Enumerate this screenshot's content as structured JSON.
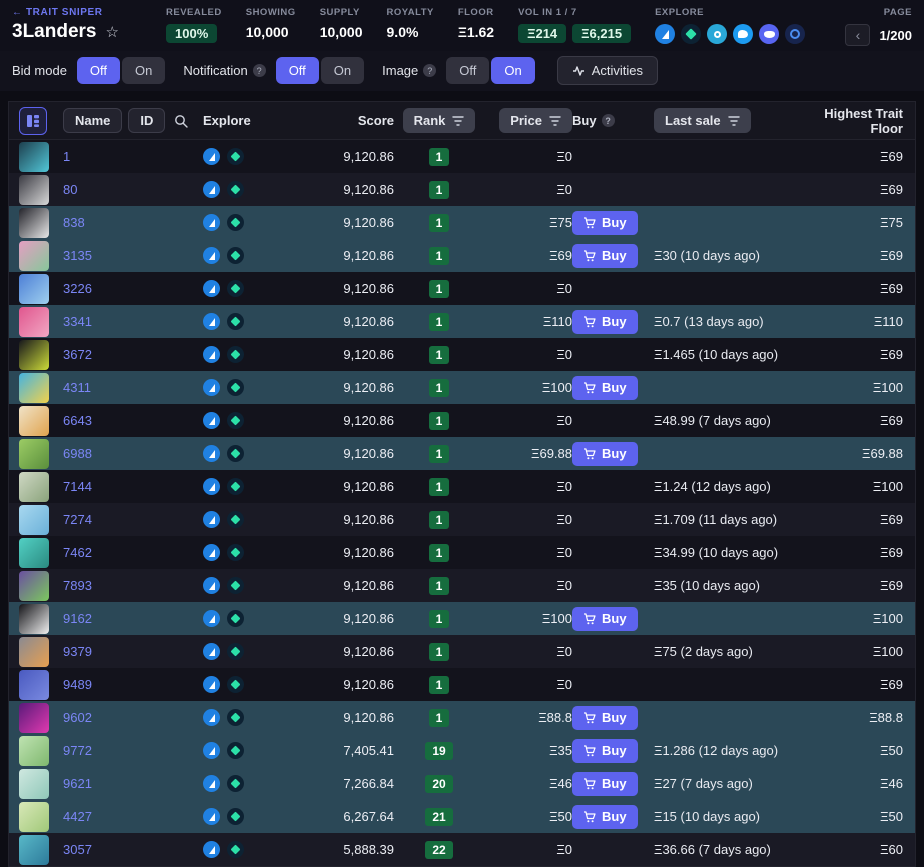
{
  "ui": {
    "help": "?",
    "star": "☆",
    "prev": "‹"
  },
  "header": {
    "breadcrumb": "← TRAIT SNIPER",
    "title": "3Landers",
    "stats": {
      "revealed": {
        "label": "REVEALED",
        "value": "100%"
      },
      "showing": {
        "label": "SHOWING",
        "value": "10,000"
      },
      "supply": {
        "label": "SUPPLY",
        "value": "10,000"
      },
      "royalty": {
        "label": "ROYALTY",
        "value": "9.0%"
      },
      "floor": {
        "label": "FLOOR",
        "value": "Ξ1.62"
      },
      "volume": {
        "label": "VOL IN 1 / 7",
        "day": "Ξ214",
        "week": "Ξ6,215"
      }
    },
    "explore_label": "EXPLORE",
    "explore_icons": [
      {
        "name": "opensea",
        "color": "#2081e2",
        "shape": "shape-sail"
      },
      {
        "name": "gem",
        "color": "#0d2233",
        "shape": "shape-diamond"
      },
      {
        "name": "x2y2",
        "color": "#2aa8d8",
        "shape": "shape-ring"
      },
      {
        "name": "twitter",
        "color": "#1d9bf0",
        "shape": "shape-bird"
      },
      {
        "name": "discord",
        "color": "#5865f2",
        "shape": "shape-blob"
      },
      {
        "name": "website",
        "color": "#17244d",
        "shape": "shape-globe"
      }
    ],
    "page_label": "PAGE",
    "page_value": "1/200"
  },
  "filterbar": {
    "bid_mode_label": "Bid mode",
    "notification_label": "Notification",
    "image_label": "Image",
    "off": "Off",
    "on": "On",
    "bid_mode_state": "Off",
    "notification_state": "Off",
    "image_state": "On",
    "activities_label": "Activities"
  },
  "table": {
    "buy_label": "Buy",
    "header": {
      "name": "Name",
      "id": "ID",
      "explore": "Explore",
      "score": "Score",
      "rank": "Rank",
      "price": "Price",
      "buy": "Buy",
      "last_sale": "Last sale",
      "highest_trait_floor": "Highest Trait Floor"
    },
    "rows": [
      {
        "id": "1",
        "score": "9,120.86",
        "rank": "1",
        "price": "Ξ0",
        "buy": false,
        "last_sale": "",
        "htf": "Ξ69",
        "thumb": [
          "#1d3f4e",
          "#52c7d8"
        ]
      },
      {
        "id": "80",
        "score": "9,120.86",
        "rank": "1",
        "price": "Ξ0",
        "buy": false,
        "last_sale": "",
        "htf": "Ξ69",
        "thumb": [
          "#3a3a42",
          "#d8d8d8"
        ]
      },
      {
        "id": "838",
        "score": "9,120.86",
        "rank": "1",
        "price": "Ξ75",
        "buy": true,
        "last_sale": "",
        "htf": "Ξ75",
        "thumb": [
          "#23232a",
          "#e8e8e8"
        ]
      },
      {
        "id": "3135",
        "score": "9,120.86",
        "rank": "1",
        "price": "Ξ69",
        "buy": true,
        "last_sale": "Ξ30 (10 days ago)",
        "htf": "Ξ69",
        "thumb": [
          "#e59ec2",
          "#86c79a"
        ]
      },
      {
        "id": "3226",
        "score": "9,120.86",
        "rank": "1",
        "price": "Ξ0",
        "buy": false,
        "last_sale": "",
        "htf": "Ξ69",
        "thumb": [
          "#4d7fd6",
          "#9fd0ef"
        ]
      },
      {
        "id": "3341",
        "score": "9,120.86",
        "rank": "1",
        "price": "Ξ110",
        "buy": true,
        "last_sale": "Ξ0.7 (13 days ago)",
        "htf": "Ξ110",
        "thumb": [
          "#e0568e",
          "#f2a7c3"
        ]
      },
      {
        "id": "3672",
        "score": "9,120.86",
        "rank": "1",
        "price": "Ξ0",
        "buy": false,
        "last_sale": "Ξ1.465 (10 days ago)",
        "htf": "Ξ69",
        "thumb": [
          "#17171c",
          "#cddc39"
        ]
      },
      {
        "id": "4311",
        "score": "9,120.86",
        "rank": "1",
        "price": "Ξ100",
        "buy": true,
        "last_sale": "",
        "htf": "Ξ100",
        "thumb": [
          "#45b3e0",
          "#f2d24b"
        ]
      },
      {
        "id": "6643",
        "score": "9,120.86",
        "rank": "1",
        "price": "Ξ0",
        "buy": false,
        "last_sale": "Ξ48.99 (7 days ago)",
        "htf": "Ξ69",
        "thumb": [
          "#f0e3c8",
          "#e0a34e"
        ]
      },
      {
        "id": "6988",
        "score": "9,120.86",
        "rank": "1",
        "price": "Ξ69.88",
        "buy": true,
        "last_sale": "",
        "htf": "Ξ69.88",
        "thumb": [
          "#9ccc65",
          "#5a8f3c"
        ]
      },
      {
        "id": "7144",
        "score": "9,120.86",
        "rank": "1",
        "price": "Ξ0",
        "buy": false,
        "last_sale": "Ξ1.24 (12 days ago)",
        "htf": "Ξ100",
        "thumb": [
          "#cfd8c4",
          "#8aa37b"
        ]
      },
      {
        "id": "7274",
        "score": "9,120.86",
        "rank": "1",
        "price": "Ξ0",
        "buy": false,
        "last_sale": "Ξ1.709 (11 days ago)",
        "htf": "Ξ69",
        "thumb": [
          "#a8d8f0",
          "#6ab0d8"
        ]
      },
      {
        "id": "7462",
        "score": "9,120.86",
        "rank": "1",
        "price": "Ξ0",
        "buy": false,
        "last_sale": "Ξ34.99 (10 days ago)",
        "htf": "Ξ69",
        "thumb": [
          "#52d0c4",
          "#2a8a80"
        ]
      },
      {
        "id": "7893",
        "score": "9,120.86",
        "rank": "1",
        "price": "Ξ0",
        "buy": false,
        "last_sale": "Ξ35 (10 days ago)",
        "htf": "Ξ69",
        "thumb": [
          "#6a4fa0",
          "#7cc95e"
        ]
      },
      {
        "id": "9162",
        "score": "9,120.86",
        "rank": "1",
        "price": "Ξ100",
        "buy": true,
        "last_sale": "",
        "htf": "Ξ100",
        "thumb": [
          "#141418",
          "#f0f0f0"
        ]
      },
      {
        "id": "9379",
        "score": "9,120.86",
        "rank": "1",
        "price": "Ξ0",
        "buy": false,
        "last_sale": "Ξ75 (2 days ago)",
        "htf": "Ξ100",
        "thumb": [
          "#8a8a92",
          "#e8a050"
        ]
      },
      {
        "id": "9489",
        "score": "9,120.86",
        "rank": "1",
        "price": "Ξ0",
        "buy": false,
        "last_sale": "",
        "htf": "Ξ69",
        "thumb": [
          "#4a5ac0",
          "#7a8ae0"
        ]
      },
      {
        "id": "9602",
        "score": "9,120.86",
        "rank": "1",
        "price": "Ξ88.8",
        "buy": true,
        "last_sale": "",
        "htf": "Ξ88.8",
        "thumb": [
          "#5a1a7a",
          "#e03ab0"
        ]
      },
      {
        "id": "9772",
        "score": "7,405.41",
        "rank": "19",
        "price": "Ξ35",
        "buy": true,
        "last_sale": "Ξ1.286 (12 days ago)",
        "htf": "Ξ50",
        "thumb": [
          "#bfe3b2",
          "#7fb86e"
        ]
      },
      {
        "id": "9621",
        "score": "7,266.84",
        "rank": "20",
        "price": "Ξ46",
        "buy": true,
        "last_sale": "Ξ27 (7 days ago)",
        "htf": "Ξ46",
        "thumb": [
          "#cfe8e0",
          "#8fc7b8"
        ]
      },
      {
        "id": "4427",
        "score": "6,267.64",
        "rank": "21",
        "price": "Ξ50",
        "buy": true,
        "last_sale": "Ξ15 (10 days ago)",
        "htf": "Ξ50",
        "thumb": [
          "#d8e8b8",
          "#a0c878"
        ]
      },
      {
        "id": "3057",
        "score": "5,888.39",
        "rank": "22",
        "price": "Ξ0",
        "buy": false,
        "last_sale": "Ξ36.66 (7 days ago)",
        "htf": "Ξ60",
        "thumb": [
          "#58b8c8",
          "#2d7a9a"
        ]
      }
    ]
  }
}
